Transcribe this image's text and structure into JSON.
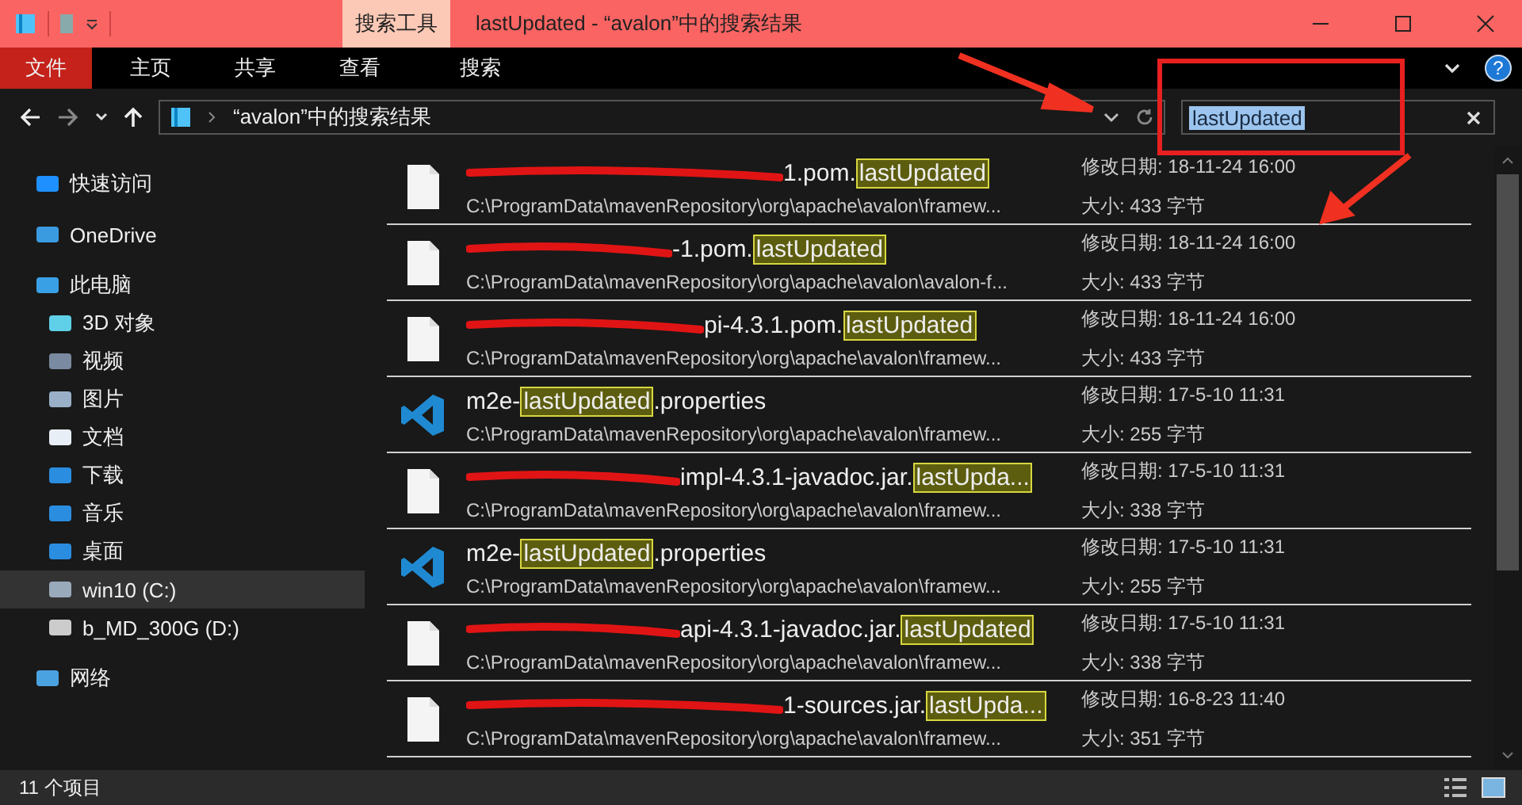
{
  "title_bar": {
    "context_tab": "搜索工具",
    "title": "lastUpdated - “avalon”中的搜索结果"
  },
  "ribbon": {
    "tabs": [
      {
        "label": "文件",
        "kind": "file"
      },
      {
        "label": "主页",
        "kind": "tab"
      },
      {
        "label": "共享",
        "kind": "tab"
      },
      {
        "label": "查看",
        "kind": "tab"
      },
      {
        "label": "搜索",
        "kind": "context"
      }
    ],
    "help": "?"
  },
  "address_bar": {
    "location": "“avalon”中的搜索结果"
  },
  "search": {
    "value": "lastUpdated"
  },
  "sidebar": {
    "items": [
      {
        "label": "快速访问",
        "selected": false
      },
      {
        "label": "OneDrive",
        "selected": false
      },
      {
        "label": "此电脑",
        "selected": false,
        "children": [
          {
            "label": "3D 对象",
            "selected": false
          },
          {
            "label": "视频",
            "selected": false
          },
          {
            "label": "图片",
            "selected": false
          },
          {
            "label": "文档",
            "selected": false
          },
          {
            "label": "下载",
            "selected": false
          },
          {
            "label": "音乐",
            "selected": false
          },
          {
            "label": "桌面",
            "selected": false
          },
          {
            "label": "win10 (C:)",
            "selected": true
          },
          {
            "label": "b_MD_300G (D:)",
            "selected": false
          }
        ]
      },
      {
        "label": "网络",
        "selected": false
      }
    ]
  },
  "results": [
    {
      "kind": "file",
      "redacted": true,
      "name": "1.pom.",
      "match": "lastUpdated",
      "path": "C:\\ProgramData\\mavenRepository\\org\\apache\\avalon\\framew...",
      "modified": "修改日期: 18-11-24 16:00",
      "size": "大小: 433 字节"
    },
    {
      "kind": "file",
      "redacted": true,
      "name": "-1.pom.",
      "match": "lastUpdated",
      "path": "C:\\ProgramData\\mavenRepository\\org\\apache\\avalon\\avalon-f...",
      "modified": "修改日期: 18-11-24 16:00",
      "size": "大小: 433 字节"
    },
    {
      "kind": "file",
      "redacted": true,
      "name": "pi-4.3.1.pom.",
      "match": "lastUpdated",
      "path": "C:\\ProgramData\\mavenRepository\\org\\apache\\avalon\\framew...",
      "modified": "修改日期: 18-11-24 16:00",
      "size": "大小: 433 字节"
    },
    {
      "kind": "code",
      "redacted": false,
      "name": "m2e-",
      "match": "lastUpdated",
      "suffix": ".properties",
      "path": "C:\\ProgramData\\mavenRepository\\org\\apache\\avalon\\framew...",
      "modified": "修改日期: 17-5-10 11:31",
      "size": "大小: 255 字节"
    },
    {
      "kind": "file",
      "redacted": true,
      "name": "impl-4.3.1-javadoc.jar.",
      "match": "lastUpda...",
      "path": "C:\\ProgramData\\mavenRepository\\org\\apache\\avalon\\framew...",
      "modified": "修改日期: 17-5-10 11:31",
      "size": "大小: 338 字节"
    },
    {
      "kind": "code",
      "redacted": false,
      "name": "m2e-",
      "match": "lastUpdated",
      "suffix": ".properties",
      "path": "C:\\ProgramData\\mavenRepository\\org\\apache\\avalon\\framew...",
      "modified": "修改日期: 17-5-10 11:31",
      "size": "大小: 255 字节"
    },
    {
      "kind": "file",
      "redacted": true,
      "name": "api-4.3.1-javadoc.jar.",
      "match": "lastUpdated",
      "path": "C:\\ProgramData\\mavenRepository\\org\\apache\\avalon\\framew...",
      "modified": "修改日期: 17-5-10 11:31",
      "size": "大小: 338 字节"
    },
    {
      "kind": "file",
      "redacted": true,
      "name": "1-sources.jar.",
      "match": "lastUpda...",
      "path": "C:\\ProgramData\\mavenRepository\\org\\apache\\avalon\\framew...",
      "modified": "修改日期: 16-8-23 11:40",
      "size": "大小: 351 字节"
    }
  ],
  "status_bar": {
    "count": "11 个项目"
  }
}
